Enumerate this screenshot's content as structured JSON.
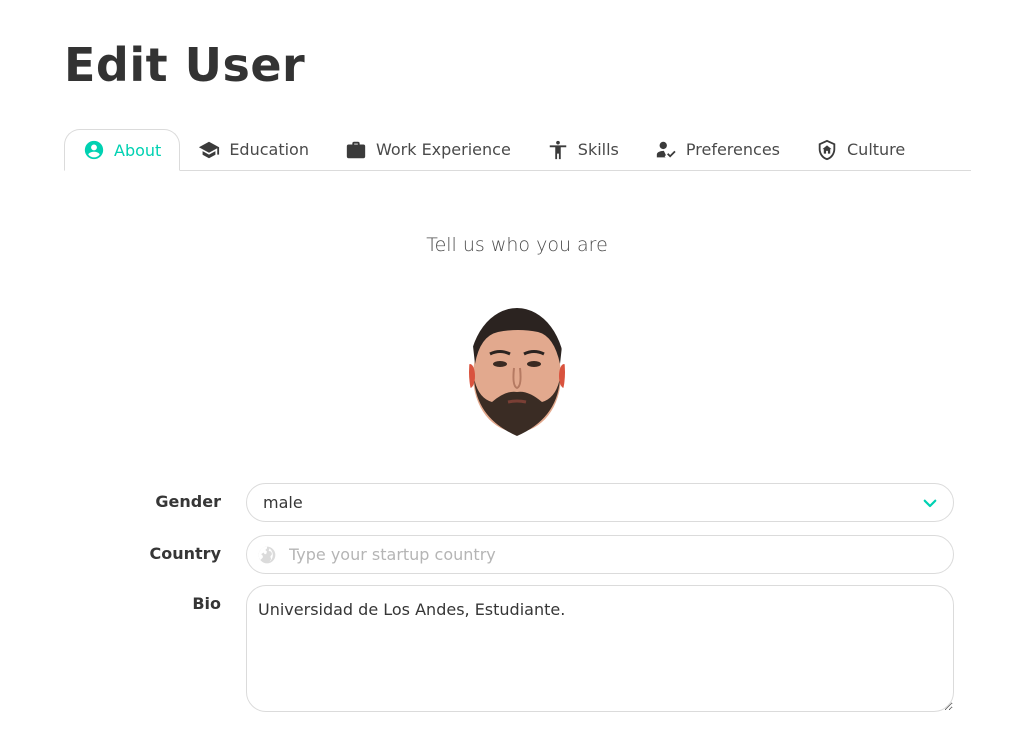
{
  "page": {
    "title": "Edit User"
  },
  "tabs": [
    {
      "label": "About",
      "icon": "account-circle-icon",
      "active": true
    },
    {
      "label": "Education",
      "icon": "graduation-cap-icon",
      "active": false
    },
    {
      "label": "Work Experience",
      "icon": "briefcase-icon",
      "active": false
    },
    {
      "label": "Skills",
      "icon": "person-standing-icon",
      "active": false
    },
    {
      "label": "Preferences",
      "icon": "person-check-icon",
      "active": false
    },
    {
      "label": "Culture",
      "icon": "shield-home-icon",
      "active": false
    }
  ],
  "about": {
    "subtitle": "Tell us who you are",
    "avatar_icon": "user-photo-avatar",
    "gender": {
      "label": "Gender",
      "value": "male"
    },
    "country": {
      "label": "Country",
      "value": "",
      "placeholder": "Type your startup country",
      "icon": "globe-icon"
    },
    "bio": {
      "label": "Bio",
      "value": "Universidad de Los Andes, Estudiante."
    }
  },
  "colors": {
    "accent": "#00d1b2",
    "border": "#dbdbdb",
    "text": "#363636"
  }
}
